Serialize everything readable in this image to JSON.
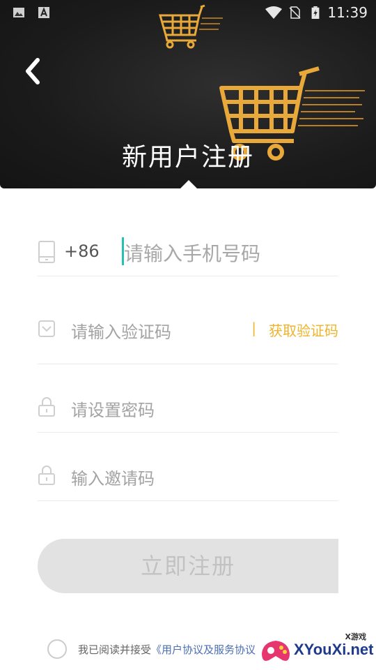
{
  "status_bar": {
    "time": "11:39",
    "left_icons": [
      "image-icon",
      "font-icon"
    ],
    "right_icons": [
      "wifi-icon",
      "no-sim-icon",
      "battery-icon"
    ]
  },
  "header": {
    "title": "新用户注册",
    "background_color": "#1b1b1b",
    "cart_color": "#e8a83a"
  },
  "form": {
    "phone": {
      "prefix": "+86",
      "placeholder": "请输入手机号码"
    },
    "code": {
      "placeholder": "请输入验证码",
      "separator": "|",
      "get_code_label": "获取验证码"
    },
    "password": {
      "placeholder": "请设置密码"
    },
    "invite": {
      "placeholder": "输入邀请码"
    },
    "cursor_color": "#25c1b5",
    "accent_color": "#f0b32a"
  },
  "submit": {
    "label": "立即注册"
  },
  "agreement": {
    "prefix": "我已阅读并接受",
    "link": "《用户协议及服务协议"
  },
  "watermark": {
    "brand": "XYouXi.net",
    "small": "X游戏"
  }
}
